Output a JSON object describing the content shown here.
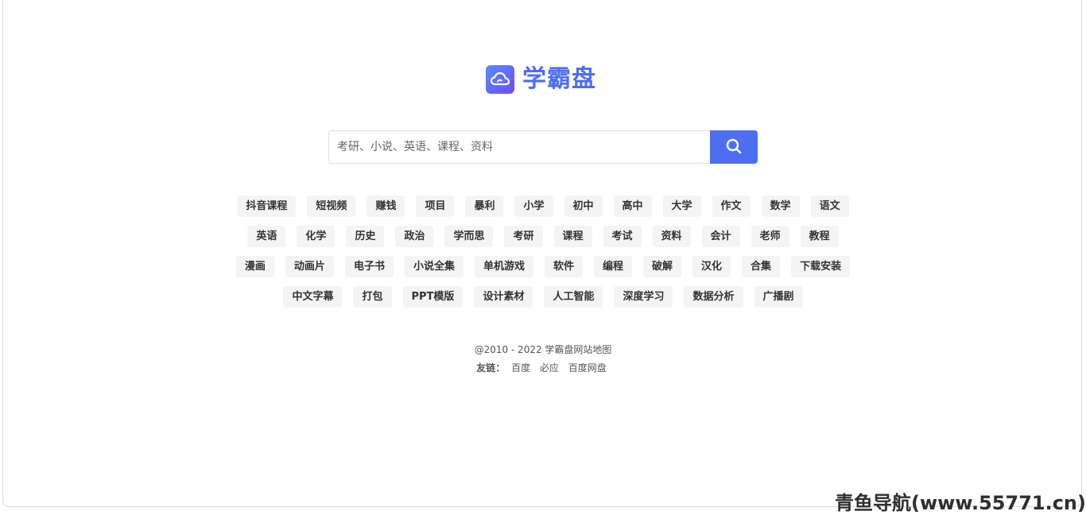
{
  "brand": {
    "title": "学霸盘",
    "icon": "cloud-icon",
    "accent_color": "#4e6ef2"
  },
  "search": {
    "placeholder": "考研、小说、英语、课程、资料",
    "value": "",
    "button_icon": "search-icon"
  },
  "tags": {
    "rows": [
      [
        "抖音课程",
        "短视频",
        "赚钱",
        "项目",
        "暴利",
        "小学",
        "初中",
        "高中",
        "大学",
        "作文",
        "数学",
        "语文"
      ],
      [
        "英语",
        "化学",
        "历史",
        "政治",
        "学而思",
        "考研",
        "课程",
        "考试",
        "资料",
        "会计",
        "老师",
        "教程"
      ],
      [
        "漫画",
        "动画片",
        "电子书",
        "小说全集",
        "单机游戏",
        "软件",
        "编程",
        "破解",
        "汉化",
        "合集",
        "下载安装"
      ],
      [
        "中文字幕",
        "打包",
        "PPT模版",
        "设计素材",
        "人工智能",
        "深度学习",
        "数据分析",
        "广播剧"
      ]
    ]
  },
  "footer": {
    "copyright": "@2010 - 2022 学霸盘网站地图",
    "friends_label": "友链：",
    "friends": [
      "百度",
      "必应",
      "百度网盘"
    ]
  },
  "watermark": {
    "text": "青鱼导航(www.55771.cn)"
  }
}
